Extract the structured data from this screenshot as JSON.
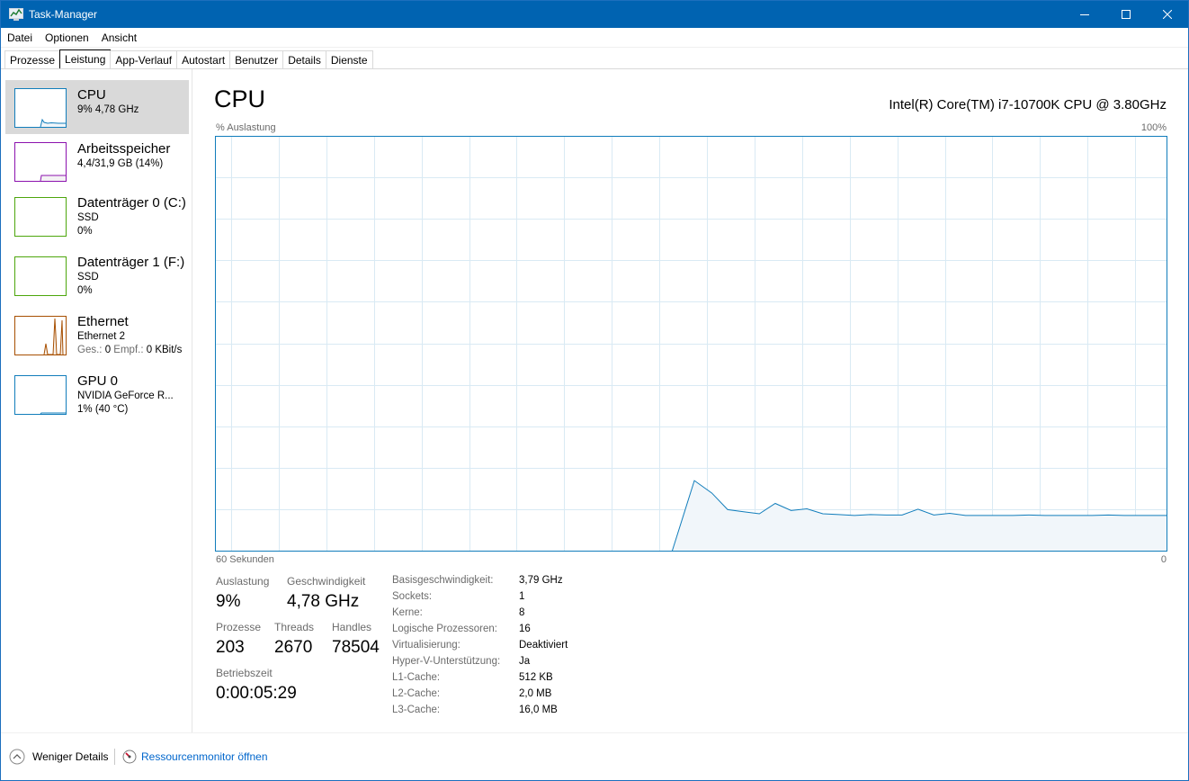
{
  "window": {
    "title": "Task-Manager",
    "controls": {
      "minimize": "minimize-icon",
      "maximize": "maximize-icon",
      "close": "close-icon"
    }
  },
  "menu": [
    "Datei",
    "Optionen",
    "Ansicht"
  ],
  "tabs": [
    "Prozesse",
    "Leistung",
    "App-Verlauf",
    "Autostart",
    "Benutzer",
    "Details",
    "Dienste"
  ],
  "active_tab": "Leistung",
  "sidebar": {
    "items": [
      {
        "title": "CPU",
        "line1": "9%  4,78 GHz",
        "line2": "",
        "color": "#117dbb",
        "selected": true
      },
      {
        "title": "Arbeitsspeicher",
        "line1": "4,4/31,9 GB (14%)",
        "line2": "",
        "color": "#8b12ae",
        "selected": false
      },
      {
        "title": "Datenträger 0 (C:)",
        "line1": "SSD",
        "line2": "0%",
        "color": "#4da60c",
        "selected": false
      },
      {
        "title": "Datenträger 1 (F:)",
        "line1": "SSD",
        "line2": "0%",
        "color": "#4da60c",
        "selected": false
      },
      {
        "title": "Ethernet",
        "line1": "Ethernet 2",
        "line2_label1": "Ges.:",
        "line2_val1": "0",
        "line2_label2": "Empf.:",
        "line2_val2": "0 KBit/s",
        "color": "#a74f01",
        "selected": false
      },
      {
        "title": "GPU 0",
        "line1": "NVIDIA GeForce R...",
        "line2": "1%  (40 °C)",
        "color": "#117dbb",
        "selected": false
      }
    ]
  },
  "main": {
    "title": "CPU",
    "model": "Intel(R) Core(TM) i7-10700K CPU @ 3.80GHz",
    "y_label": "% Auslastung",
    "y_max_label": "100%",
    "x_left_label": "60 Sekunden",
    "x_right_label": "0"
  },
  "stats": {
    "auslastung_label": "Auslastung",
    "auslastung": "9%",
    "geschwindigkeit_label": "Geschwindigkeit",
    "geschwindigkeit": "4,78 GHz",
    "prozesse_label": "Prozesse",
    "prozesse": "203",
    "threads_label": "Threads",
    "threads": "2670",
    "handles_label": "Handles",
    "handles": "78504",
    "betriebszeit_label": "Betriebszeit",
    "betriebszeit": "0:00:05:29"
  },
  "info": [
    {
      "key": "Basisgeschwindigkeit:",
      "value": "3,79 GHz"
    },
    {
      "key": "Sockets:",
      "value": "1"
    },
    {
      "key": "Kerne:",
      "value": "8"
    },
    {
      "key": "Logische Prozessoren:",
      "value": "16"
    },
    {
      "key": "Virtualisierung:",
      "value": "Deaktiviert"
    },
    {
      "key": "Hyper-V-Unterstützung:",
      "value": "Ja"
    },
    {
      "key": "L1-Cache:",
      "value": "512 KB"
    },
    {
      "key": "L2-Cache:",
      "value": "2,0 MB"
    },
    {
      "key": "L3-Cache:",
      "value": "16,0 MB"
    }
  ],
  "footer": {
    "less_details": "Weniger Details",
    "resource_monitor": "Ressourcenmonitor öffnen"
  },
  "chart_data": {
    "type": "area",
    "color": "#117dbb",
    "fill": "#f1f6fa",
    "ylim": [
      0,
      100
    ],
    "xlim": [
      60,
      0
    ],
    "x": [
      31.2,
      29.8,
      28.7,
      27.7,
      26.7,
      25.7,
      24.7,
      23.7,
      22.7,
      21.7,
      20.7,
      19.7,
      18.7,
      17.7,
      16.7,
      15.7,
      14.7,
      13.7,
      12.7,
      11.7,
      10.7,
      9.7,
      8.7,
      7.7,
      6.7,
      5.7,
      4.7,
      3.7,
      2.7,
      1.7,
      0.7,
      0
    ],
    "y": [
      0,
      17,
      14,
      10,
      9.5,
      9,
      11.5,
      9.8,
      10.2,
      9,
      8.8,
      8.6,
      8.8,
      8.7,
      8.7,
      10.1,
      8.7,
      9.1,
      8.6,
      8.6,
      8.6,
      8.6,
      8.7,
      8.6,
      8.6,
      8.6,
      8.6,
      8.7,
      8.6,
      8.6,
      8.6,
      8.6
    ]
  }
}
